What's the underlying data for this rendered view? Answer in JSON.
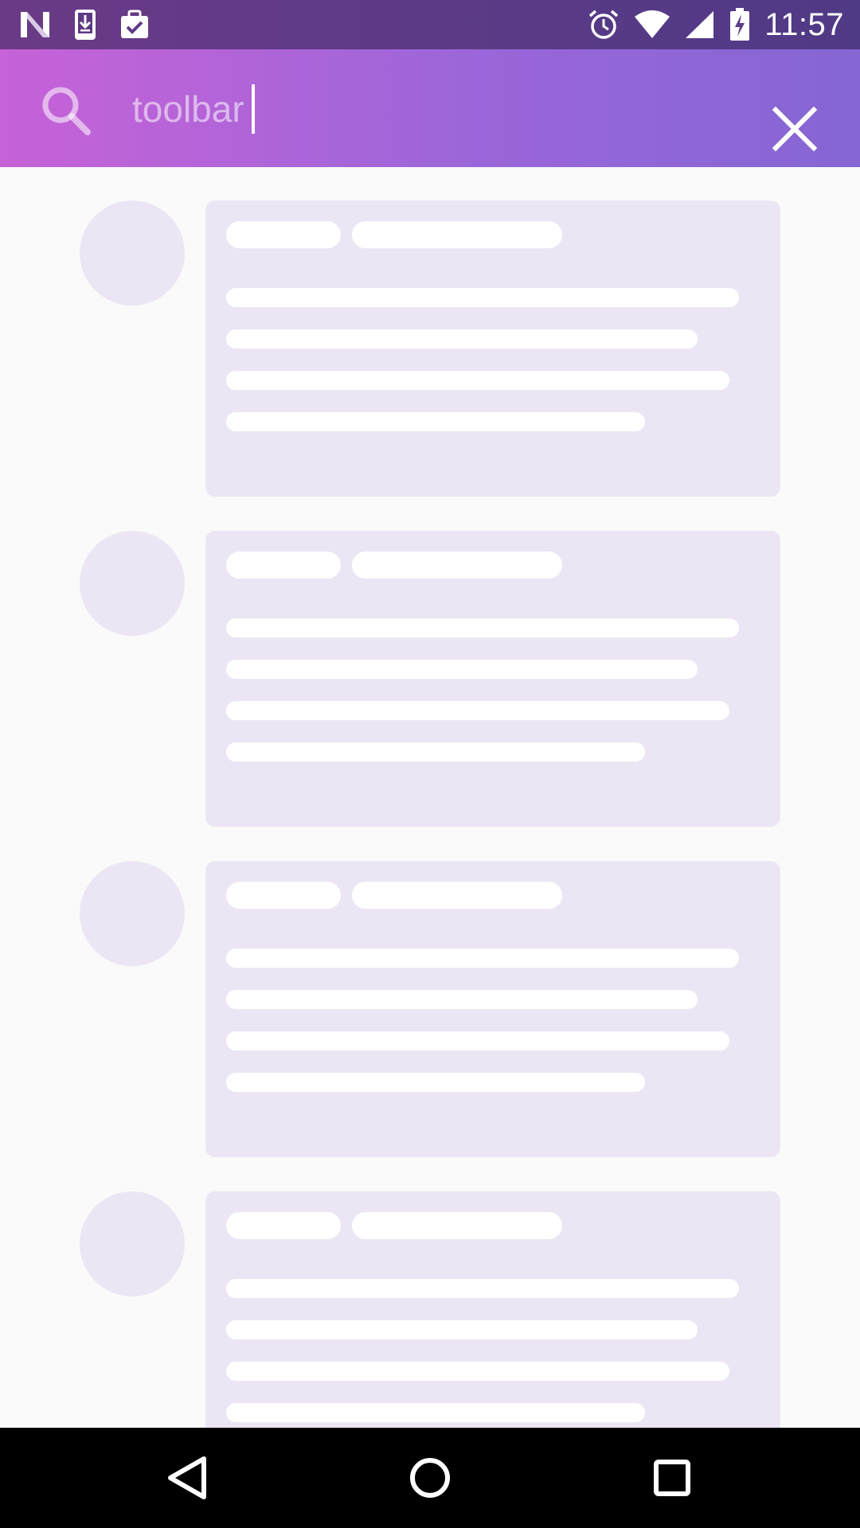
{
  "status_bar": {
    "time": "11:57",
    "left_icons": [
      "n-logo-icon",
      "download-icon",
      "briefcase-check-icon"
    ],
    "right_icons": [
      "alarm-icon",
      "wifi-icon",
      "signal-icon",
      "battery-charging-icon"
    ]
  },
  "toolbar": {
    "search_value": "toolbar",
    "search_icon": "search-icon",
    "close_icon": "close-icon",
    "gradient": [
      "#c762d8",
      "#8566d3"
    ]
  },
  "list": {
    "placeholder_count": 4,
    "placeholder_color": "#ece6f4"
  },
  "nav_bar": {
    "buttons": [
      "back-icon",
      "home-icon",
      "recents-icon"
    ]
  }
}
